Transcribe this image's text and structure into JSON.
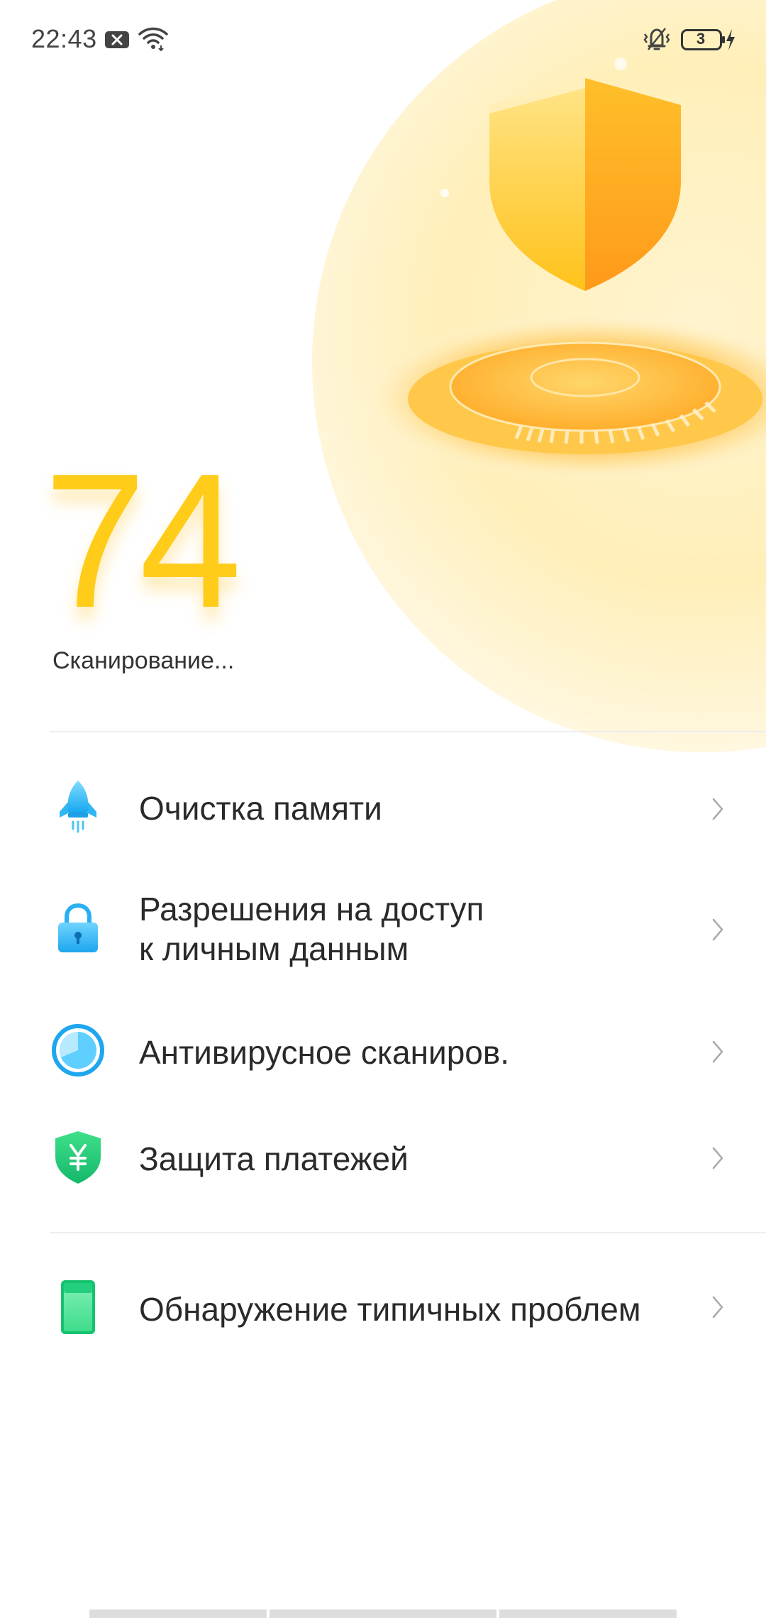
{
  "status_bar": {
    "time": "22:43",
    "icons": [
      "notification-x-icon",
      "wifi-icon",
      "vibrate-icon",
      "battery-icon",
      "charging-icon"
    ],
    "battery_level": "3"
  },
  "scan": {
    "score": "74",
    "status": "Сканирование..."
  },
  "colors": {
    "accent_yellow": "#ffcc1a",
    "accent_orange": "#ffa11a",
    "text_primary": "#2a2a2a",
    "divider": "#eeeeee"
  },
  "items": [
    {
      "id": "memory-cleanup",
      "label": "Очистка памяти",
      "icon": "rocket-icon"
    },
    {
      "id": "permissions",
      "label_line1": "Разрешения на доступ",
      "label_line2": "к личным данным",
      "icon": "lock-icon"
    },
    {
      "id": "antivirus",
      "label": "Антивирусное сканиров.",
      "icon": "antivirus-scan-icon"
    },
    {
      "id": "payment-protection",
      "label": "Защита платежей",
      "icon": "payment-shield-icon"
    },
    {
      "id": "problem-detection",
      "label": "Обнаружение типичных проблем",
      "icon": "phone-icon"
    }
  ]
}
